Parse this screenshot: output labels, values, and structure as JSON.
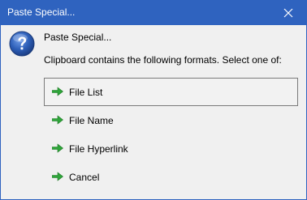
{
  "window": {
    "title": "Paste Special...",
    "close_icon": "close-icon"
  },
  "dialog": {
    "icon": "help-question-icon",
    "heading": "Paste Special...",
    "instruction": "Clipboard contains the following formats. Select one of:",
    "options": [
      {
        "label": "File List",
        "icon": "green-arrow-icon",
        "selected": true
      },
      {
        "label": "File Name",
        "icon": "green-arrow-icon",
        "selected": false
      },
      {
        "label": "File Hyperlink",
        "icon": "green-arrow-icon",
        "selected": false
      },
      {
        "label": "Cancel",
        "icon": "green-arrow-icon",
        "selected": false
      }
    ]
  },
  "colors": {
    "titlebar": "#2f63bf",
    "background": "#f0f0f0",
    "arrow": "#2fa53a"
  }
}
